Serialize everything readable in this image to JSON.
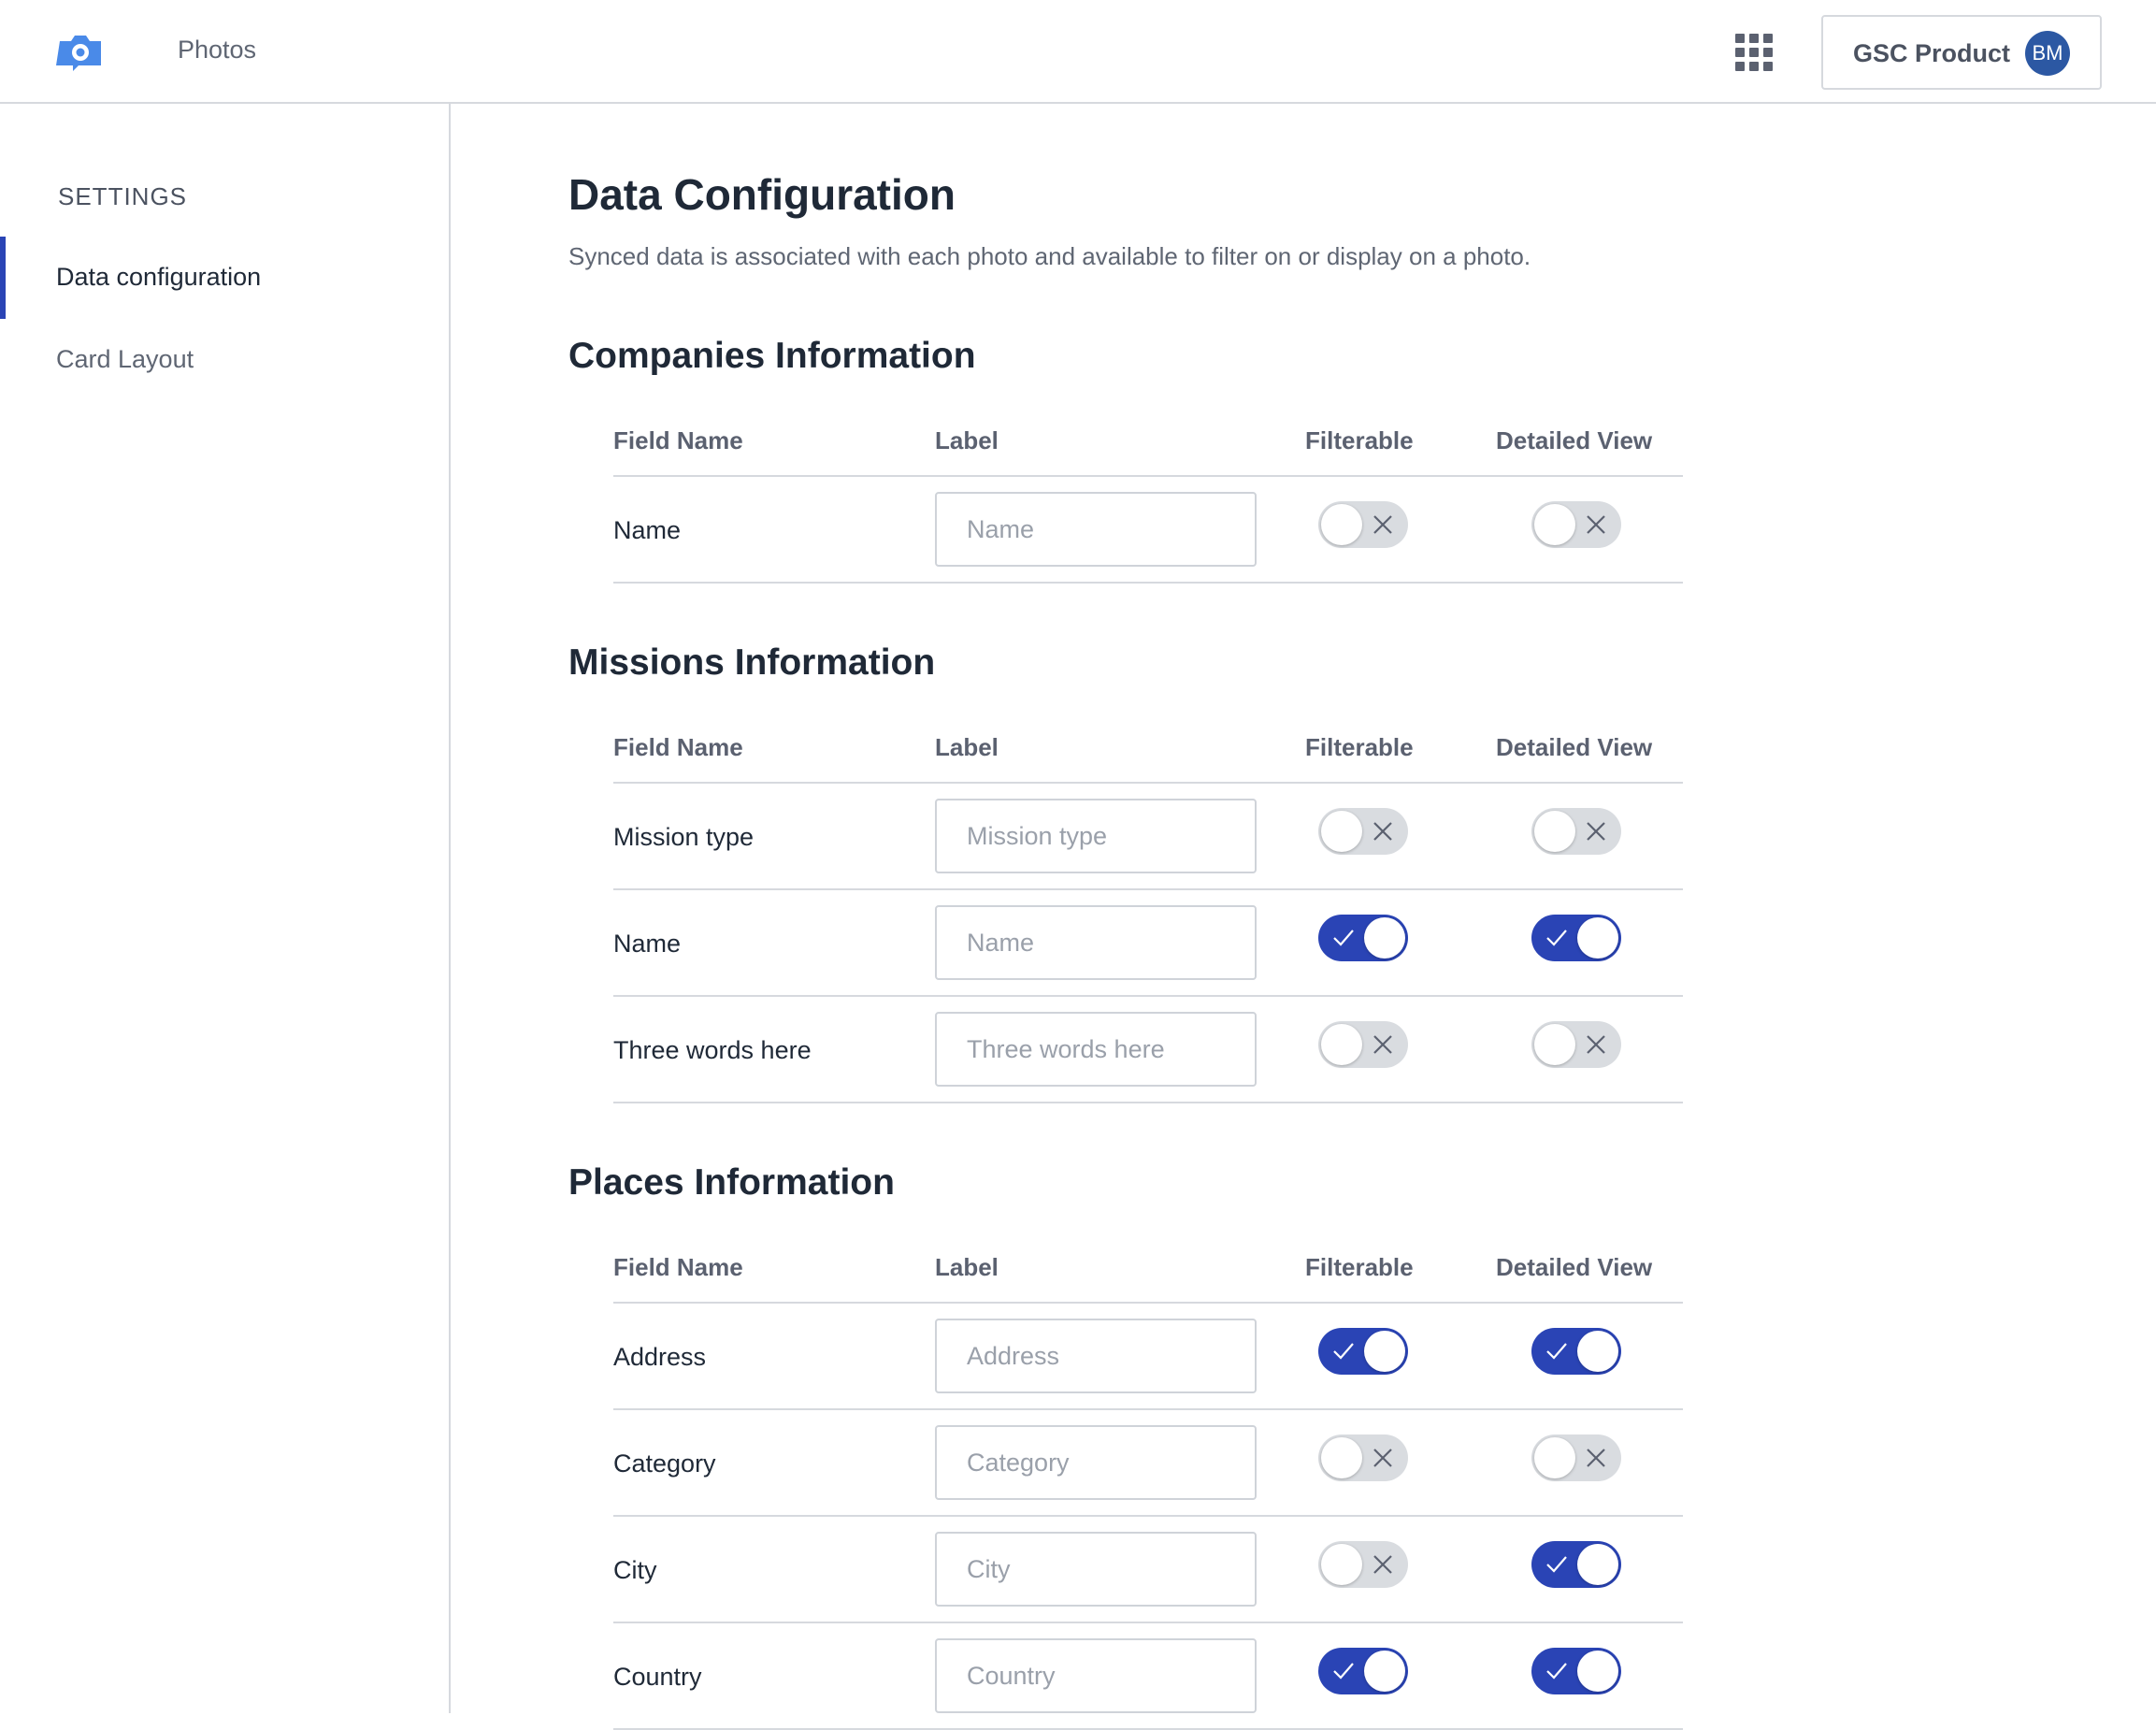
{
  "app": {
    "name": "Photos",
    "logo_icon": "camera-icon"
  },
  "header": {
    "apps_icon": "apps-grid-icon",
    "account_name": "GSC Product",
    "avatar_initials": "BM"
  },
  "sidebar": {
    "heading": "SETTINGS",
    "items": [
      {
        "label": "Data configuration",
        "active": true
      },
      {
        "label": "Card Layout",
        "active": false
      }
    ]
  },
  "page": {
    "title": "Data Configuration",
    "description": "Synced data is associated with each photo and available to filter on or display on a photo."
  },
  "columns": {
    "field_name": "Field Name",
    "label": "Label",
    "filterable": "Filterable",
    "detailed_view": "Detailed View"
  },
  "colors": {
    "accent": "#2a44b5",
    "toggle_off": "#d9dce0",
    "avatar": "#2c58a3"
  },
  "sections": [
    {
      "title": "Companies Information",
      "rows": [
        {
          "field": "Name",
          "placeholder": "Name",
          "filterable": false,
          "detailed": false
        }
      ]
    },
    {
      "title": "Missions Information",
      "rows": [
        {
          "field": "Mission type",
          "placeholder": "Mission type",
          "filterable": false,
          "detailed": false
        },
        {
          "field": "Name",
          "placeholder": "Name",
          "filterable": true,
          "detailed": true
        },
        {
          "field": "Three words here",
          "placeholder": "Three words here",
          "filterable": false,
          "detailed": false
        }
      ]
    },
    {
      "title": "Places Information",
      "rows": [
        {
          "field": "Address",
          "placeholder": "Address",
          "filterable": true,
          "detailed": true
        },
        {
          "field": "Category",
          "placeholder": "Category",
          "filterable": false,
          "detailed": false
        },
        {
          "field": "City",
          "placeholder": "City",
          "filterable": false,
          "detailed": true
        },
        {
          "field": "Country",
          "placeholder": "Country",
          "filterable": true,
          "detailed": true
        }
      ]
    }
  ]
}
